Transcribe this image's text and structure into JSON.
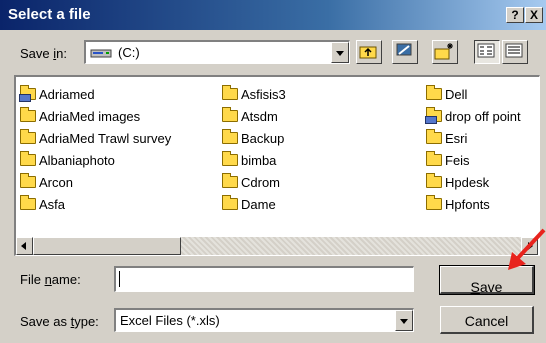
{
  "window": {
    "title": "Select a file",
    "help_label": "?",
    "close_label": "X"
  },
  "save_in": {
    "label_pre": "Save ",
    "label_underlined": "i",
    "label_post": "n:",
    "value": "(C:)"
  },
  "files": {
    "column1": [
      "Adriamed",
      "AdriaMed images",
      "AdriaMed Trawl survey",
      "Albaniaphoto",
      "Arcon",
      "Asfa"
    ],
    "column2": [
      "Asfisis3",
      "Atsdm",
      "Backup",
      "bimba",
      "Cdrom",
      "Dame"
    ],
    "column3": [
      "Dell",
      "drop off point",
      "Esri",
      "Feis",
      "Hpdesk",
      "Hpfonts"
    ]
  },
  "file_name": {
    "label_pre": "File ",
    "label_underlined": "n",
    "label_post": "ame:",
    "value": ""
  },
  "save_as_type": {
    "label_pre": "Save as ",
    "label_underlined": "t",
    "label_post": "ype:",
    "value": "Excel Files (*.xls)"
  },
  "buttons": {
    "save_underlined": "S",
    "save_rest": "ave",
    "cancel": "Cancel"
  },
  "colors": {
    "accent_arrow": "#e8231d",
    "titlebar": "#0a246a",
    "dialog_face": "#d4d0c8"
  }
}
